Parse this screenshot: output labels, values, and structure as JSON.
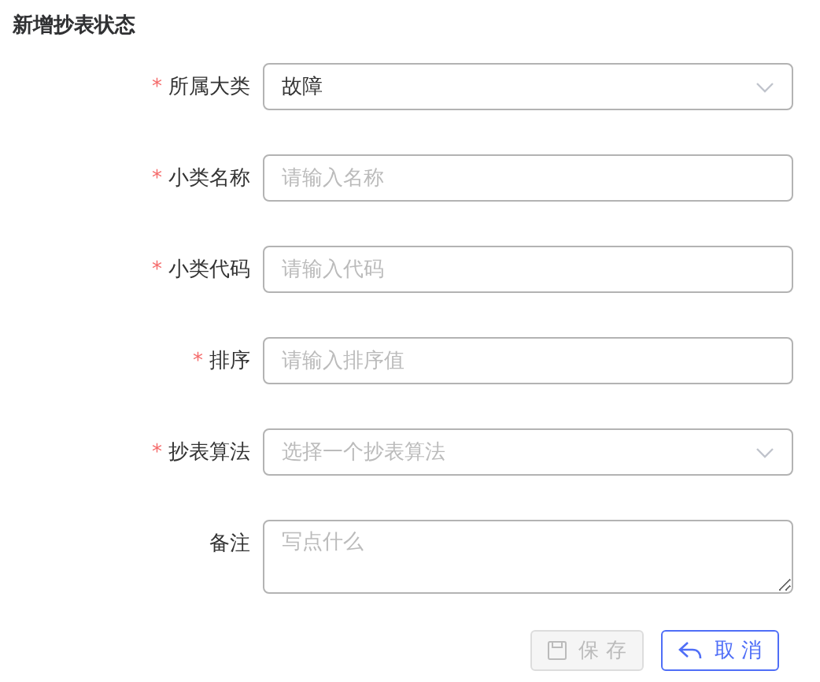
{
  "title": "新增抄表状态",
  "fields": [
    {
      "mark": "*",
      "label": "所属大类",
      "kind": "select",
      "value": "故障"
    },
    {
      "mark": "*",
      "label": "小类名称",
      "kind": "input",
      "placeholder": "请输入名称"
    },
    {
      "mark": "*",
      "label": "小类代码",
      "kind": "input",
      "placeholder": "请输入代码"
    },
    {
      "mark": "*",
      "label": "排序",
      "kind": "input",
      "placeholder": "请输入排序值"
    },
    {
      "mark": "*",
      "label": "抄表算法",
      "kind": "select",
      "placeholder": "选择一个抄表算法"
    },
    {
      "label": "备注",
      "kind": "textarea",
      "placeholder": "写点什么"
    }
  ],
  "buttons": [
    {
      "label": "保 存",
      "kind": "save",
      "disabled": true
    },
    {
      "label": "取 消",
      "kind": "cancel",
      "disabled": false
    }
  ]
}
